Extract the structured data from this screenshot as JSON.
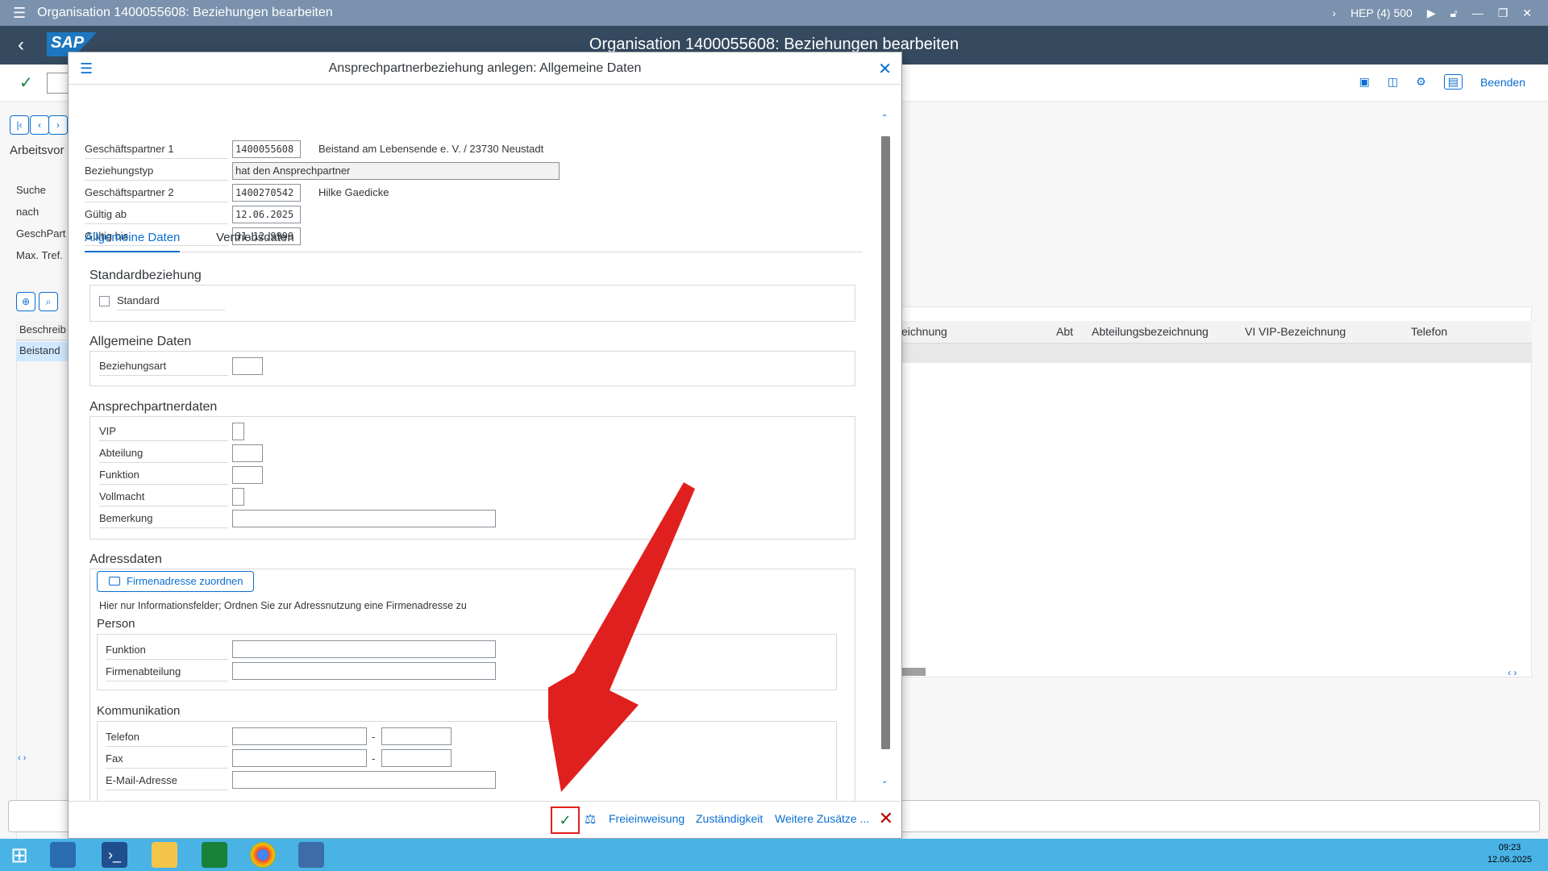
{
  "window": {
    "title": "Organisation 1400055608: Beziehungen bearbeiten",
    "system": "HEP (4) 500"
  },
  "shell": {
    "logo": "SAP",
    "title": "Organisation 1400055608: Beziehungen bearbeiten"
  },
  "toolbar": {
    "exit_label": "Beenden"
  },
  "left_panel": {
    "worklist_label": "Arbeitsvor",
    "search_label": "Suche",
    "by_label": "nach",
    "bp_label": "GeschPart",
    "max_label": "Max. Tref.",
    "col_label": "Beschreib",
    "row_label": "Beistand"
  },
  "right_grid": {
    "columns": [
      "eichnung",
      "Abt",
      "Abteilungsbezeichnung",
      "VI",
      "VIP-Bezeichnung",
      "Telefon"
    ]
  },
  "dialog": {
    "title": "Ansprechpartnerbeziehung anlegen: Allgemeine Daten",
    "header_fields": {
      "bp1_label": "Geschäftspartner 1",
      "bp1_value": "1400055608",
      "bp1_desc": "Beistand am Lebensende e. V. / 23730 Neustadt",
      "reltype_label": "Beziehungstyp",
      "reltype_value": "hat den Ansprechpartner",
      "bp2_label": "Geschäftspartner 2",
      "bp2_value": "1400270542",
      "bp2_desc": "Hilke Gaedicke",
      "valid_from_label": "Gültig ab",
      "valid_from_value": "12.06.2025",
      "valid_to_label": "Gültig bis",
      "valid_to_value": "31.12.9999"
    },
    "tabs": [
      "Allgemeine Daten",
      "Vertriebsdaten"
    ],
    "sections": {
      "standard": {
        "title": "Standardbeziehung",
        "checkbox_label": "Standard"
      },
      "general": {
        "title": "Allgemeine Daten",
        "reltype_label": "Beziehungsart"
      },
      "contact": {
        "title": "Ansprechpartnerdaten",
        "vip_label": "VIP",
        "dept_label": "Abteilung",
        "function_label": "Funktion",
        "poa_label": "Vollmacht",
        "remark_label": "Bemerkung"
      },
      "address": {
        "title": "Adressdaten",
        "assign_button": "Firmenadresse zuordnen",
        "info_text": "Hier nur Informationsfelder; Ordnen Sie zur Adressnutzung eine Firmenadresse zu",
        "person_title": "Person",
        "function_label": "Funktion",
        "company_dept_label": "Firmenabteilung",
        "comm_title": "Kommunikation",
        "phone_label": "Telefon",
        "fax_label": "Fax",
        "email_label": "E-Mail-Adresse",
        "dash": "-"
      }
    },
    "footer": {
      "release_label": "Freieinweisung",
      "responsibility_label": "Zuständigkeit",
      "more_label": "Weitere Zusätze ..."
    }
  },
  "tray": {
    "time": "09:23",
    "date": "12.06.2025"
  },
  "colors": {
    "shell": "#354a5f",
    "titlebar": "#7a92ad",
    "accent": "#0a6ed1",
    "ok_green": "#107e3e",
    "cancel_red": "#bb0000",
    "highlight_red": "#e0201e",
    "taskbar": "#4ab3e6"
  }
}
